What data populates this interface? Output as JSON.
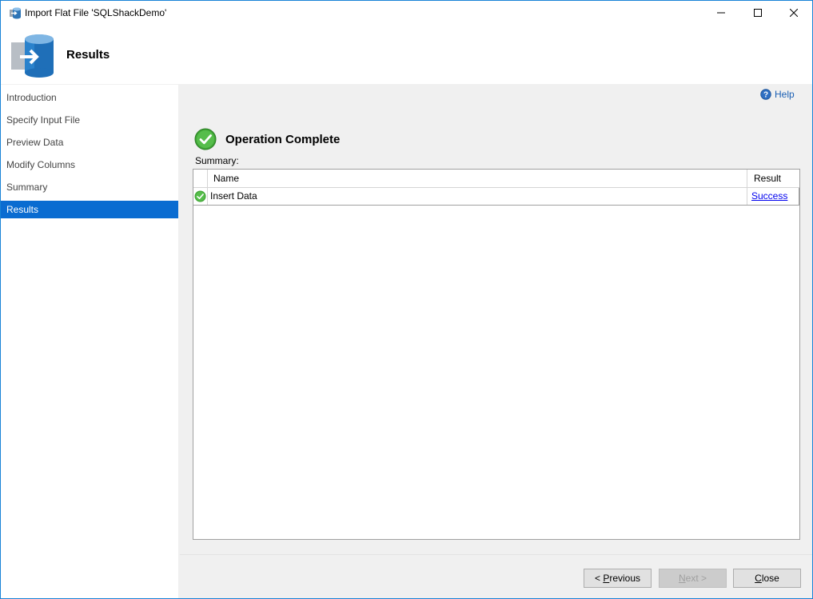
{
  "window": {
    "title": "Import Flat File 'SQLShackDemo'"
  },
  "header": {
    "title": "Results"
  },
  "sidebar": {
    "items": [
      {
        "label": "Introduction",
        "active": false
      },
      {
        "label": "Specify Input File",
        "active": false
      },
      {
        "label": "Preview Data",
        "active": false
      },
      {
        "label": "Modify Columns",
        "active": false
      },
      {
        "label": "Summary",
        "active": false
      },
      {
        "label": "Results",
        "active": true
      }
    ]
  },
  "main": {
    "help_label": "Help",
    "operation_title": "Operation Complete",
    "summary_label": "Summary:",
    "table": {
      "columns": [
        "Name",
        "Result"
      ],
      "rows": [
        {
          "name": "Insert Data",
          "result": "Success",
          "status_icon": "success-check-icon"
        }
      ]
    }
  },
  "footer": {
    "previous_prefix": "< ",
    "previous_accel": "P",
    "previous_rest": "revious",
    "next_accel": "N",
    "next_rest": "ext >",
    "next_enabled": false,
    "close_accel": "C",
    "close_rest": "lose"
  },
  "colors": {
    "accent": "#0a6cd1",
    "window_border": "#1883d7",
    "success": "#3fa535",
    "link": "#0000ee"
  }
}
